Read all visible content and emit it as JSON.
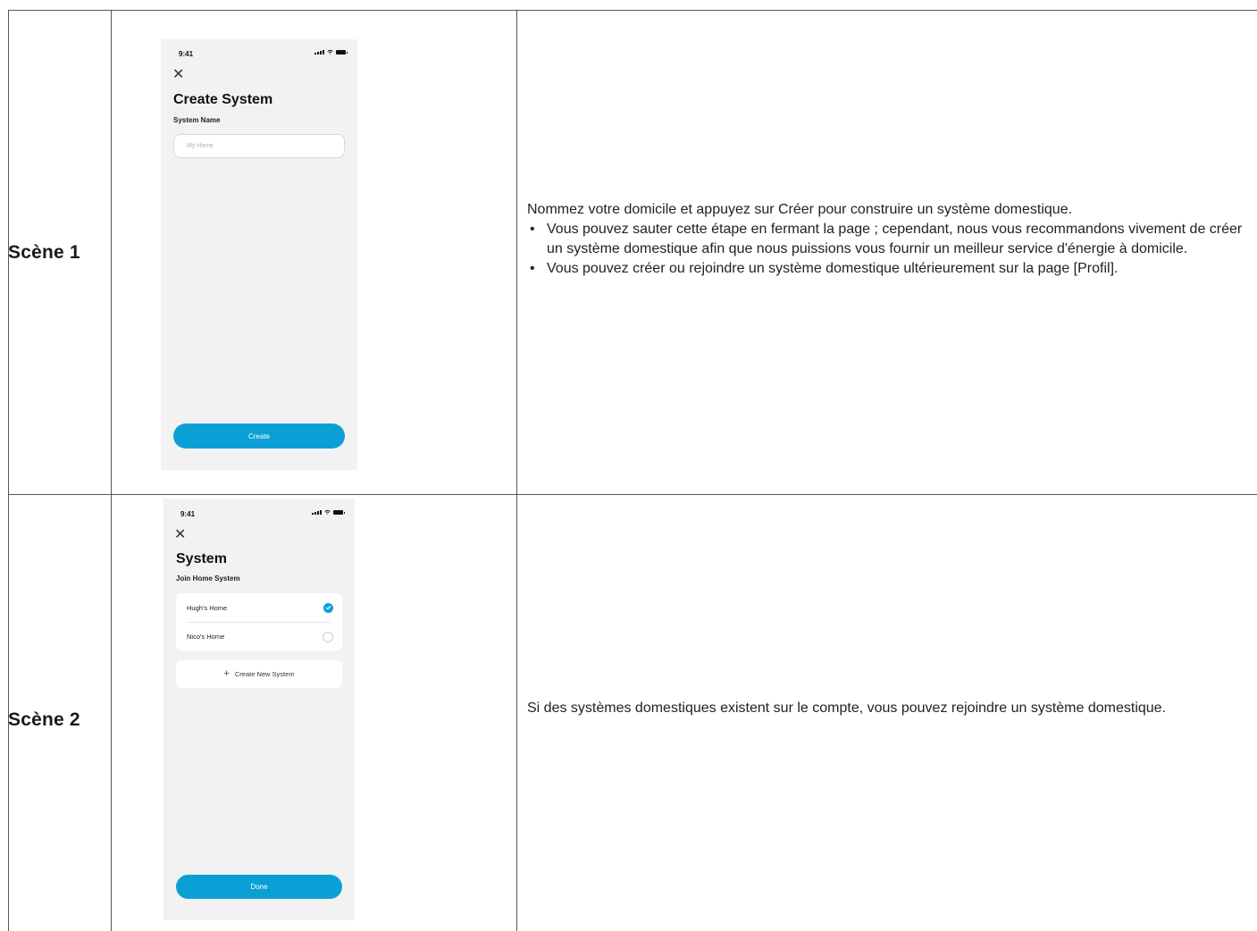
{
  "rows": [
    {
      "scene_label": "Scène 1",
      "phone": {
        "time": "9:41",
        "title": "Create System",
        "subtitle": "System Name",
        "input_placeholder": "My Home",
        "button_label": "Create"
      },
      "description": {
        "intro": "Nommez votre domicile et appuyez sur Créer pour construire un système domestique.",
        "bullets": [
          "Vous pouvez sauter cette étape en fermant la page ; cependant, nous vous recommandons vivement de créer un système domestique afin que nous puissions vous fournir un meilleur service d'énergie à domicile.",
          "Vous pouvez créer ou rejoindre un système domestique ultérieurement sur la page [Profil]."
        ]
      }
    },
    {
      "scene_label": "Scène 2",
      "phone": {
        "time": "9:41",
        "title": "System",
        "subtitle": "Join Home System",
        "systems": [
          {
            "name": "Hugh's Home",
            "selected": true
          },
          {
            "name": "Nico's Home",
            "selected": false
          }
        ],
        "create_new_label": "Create New System",
        "button_label": "Done"
      },
      "description": {
        "intro": "Si des systèmes domestiques existent sur le compte, vous pouvez rejoindre un système domestique."
      }
    }
  ],
  "colors": {
    "accent": "#0aa0d6",
    "phone_bg": "#f2f2f2",
    "grid_line": "#555555"
  },
  "icons": [
    "close-icon",
    "signal-icon",
    "wifi-icon",
    "battery-icon",
    "check-icon",
    "plus-icon"
  ]
}
